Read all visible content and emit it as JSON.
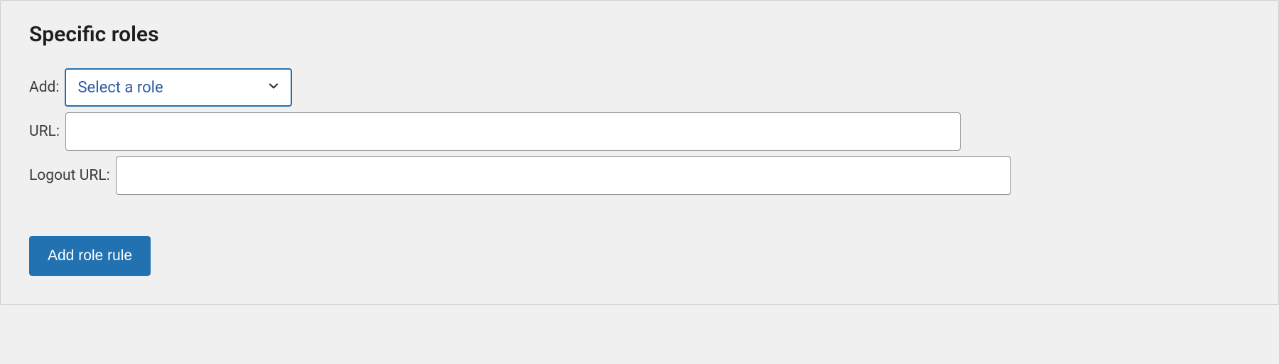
{
  "section": {
    "title": "Specific roles"
  },
  "fields": {
    "add_label": "Add:",
    "role_select_placeholder": "Select a role",
    "url_label": "URL:",
    "url_value": "",
    "logout_url_label": "Logout URL:",
    "logout_url_value": ""
  },
  "buttons": {
    "add_role_rule": "Add role rule"
  }
}
